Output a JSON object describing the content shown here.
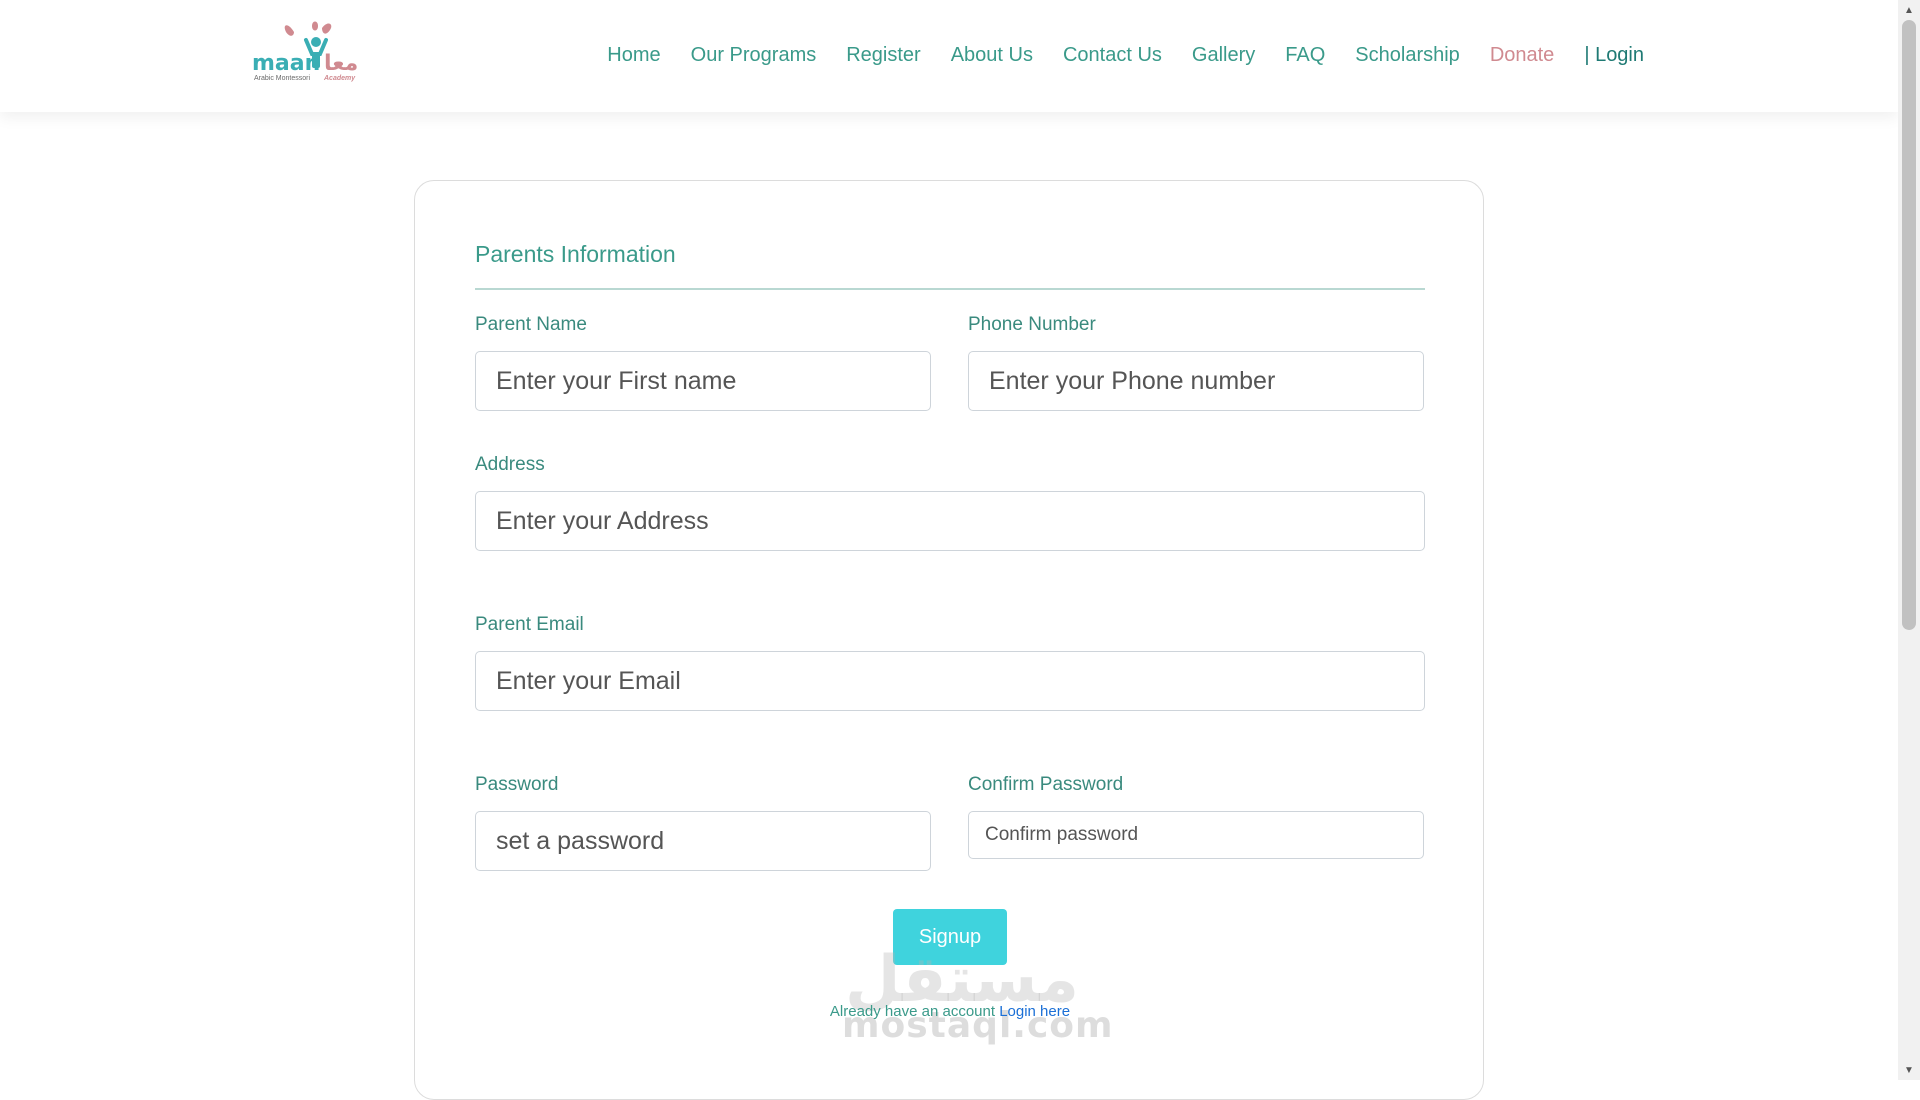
{
  "brand": {
    "logo_latin": "maan",
    "logo_arabic": "معا",
    "tagline_1": "Arabic Montessori",
    "tagline_2": "Academy"
  },
  "nav": {
    "items": [
      {
        "label": "Home"
      },
      {
        "label": "Our Programs"
      },
      {
        "label": "Register"
      },
      {
        "label": "About Us"
      },
      {
        "label": "Contact Us"
      },
      {
        "label": "Gallery"
      },
      {
        "label": "FAQ"
      },
      {
        "label": "Scholarship"
      }
    ],
    "donate": "Donate",
    "login": "| Login"
  },
  "form": {
    "section_title": "Parents Information",
    "parent_name": {
      "label": "Parent Name",
      "placeholder": "Enter your First name"
    },
    "phone": {
      "label": "Phone Number",
      "placeholder": "Enter your Phone number"
    },
    "address": {
      "label": "Address",
      "placeholder": "Enter your Address"
    },
    "email": {
      "label": "Parent Email",
      "placeholder": "Enter your Email"
    },
    "password": {
      "label": "Password",
      "placeholder": "set a password"
    },
    "confirm_password": {
      "label": "Confirm Password",
      "placeholder": "Confirm password"
    },
    "submit_label": "Signup",
    "already_text": "Already have an account ",
    "login_link": "Login here"
  },
  "watermark": {
    "arabic": "مستقل",
    "latin": "mostaql.com"
  },
  "colors": {
    "accent": "#3a9a8a",
    "donate": "#d08a90",
    "button": "#3fd3dd",
    "link": "#1a6fd6"
  }
}
